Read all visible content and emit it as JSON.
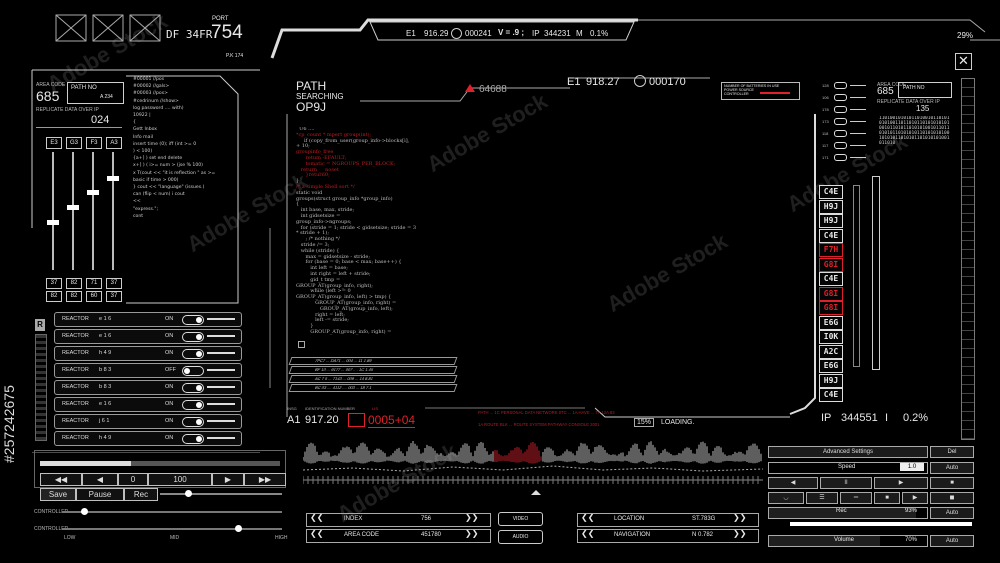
{
  "watermark": {
    "text": "Adobe Stock",
    "side_id": "#257242675"
  },
  "port": {
    "label": "PORT",
    "code": "DF 34FR",
    "value": "754",
    "sub": "P.K 174"
  },
  "top_bar": {
    "e1_label": "E1",
    "e1_value": "916.29",
    "counter": "000241",
    "v_label": "V = .9 ;",
    "ip_label": "IP",
    "ip_value": "344231",
    "m_label": "M",
    "m_value": "0.1%",
    "percent": "29%"
  },
  "area_code": {
    "label": "AREA CODE",
    "value": "685",
    "path_no_label": "PATH NO",
    "path_no_sub": "A 234",
    "replicate_label": "REPLICATE DATA OVER IP",
    "replicate_value": "024"
  },
  "notes_panel": {
    "lines": [
      "#00001 //pos",
      "#00002 //gals>",
      "#00003 //pos>",
      "#cedrinum //show>",
      "log password .... with)",
      "10922 |",
      "{ ",
      "Gett Inbox",
      "Info mail",
      "insert time (0); iff (int >= 0",
      ") < 100)",
      "{a+] ) set end delete",
      "x+] ) ( i>= num > (jse % 100)",
      "x T(cout << \"it is reflection \" as >= basic if time > 000)",
      "} cout << \"language\" (issues.)",
      "can (flip < num) i cout",
      "<<",
      "\"express.\";",
      "cont"
    ]
  },
  "sliders": {
    "labels": [
      "E3",
      "G3",
      "F3",
      "A3"
    ],
    "levels": [
      0.42,
      0.55,
      0.68,
      0.8
    ],
    "row1": [
      "37",
      "82",
      "71",
      "37"
    ],
    "row2": [
      "82",
      "82",
      "60",
      "37"
    ]
  },
  "r_badge": "R",
  "reactors": [
    {
      "name": "REACTOR",
      "id": "e 1 6",
      "state": "ON",
      "on": true
    },
    {
      "name": "REACTOR",
      "id": "e 1 6",
      "state": "ON",
      "on": true
    },
    {
      "name": "REACTOR",
      "id": "h 4 9",
      "state": "ON",
      "on": true
    },
    {
      "name": "REACTOR",
      "id": "b 8 3",
      "state": "OFF",
      "on": false
    },
    {
      "name": "REACTOR",
      "id": "b 8 3",
      "state": "ON",
      "on": true
    },
    {
      "name": "REACTOR",
      "id": "e 1 6",
      "state": "ON",
      "on": true
    },
    {
      "name": "REACTOR",
      "id": "j 6 1",
      "state": "ON",
      "on": true
    },
    {
      "name": "REACTOR",
      "id": "h 4 9",
      "state": "ON",
      "on": true
    }
  ],
  "transport": {
    "rewind": "◀◀",
    "back": "◀",
    "start": "0",
    "end": "100",
    "play": "▶",
    "ffwd": "▶▶",
    "save": "Save",
    "pause": "Pause",
    "rec": "Rec",
    "position": 0.38
  },
  "controllers": {
    "c1_label": "CONTROLLER",
    "c2_label": "CONTROLLER",
    "low": "LOW",
    "mid": "MID",
    "high": "HIGH",
    "c1_level": 0.1,
    "c2_level": 0.8
  },
  "path": {
    "title": "PATH",
    "status": "SEARCHING",
    "code": "OP9J",
    "alert_value": "64688",
    "e1_label": "E1",
    "e1_value": "918.27",
    "counter": "000170"
  },
  "code_lines": [
    {
      "t": "  U6 ....",
      "red": false
    },
    {
      "t": "*cp_count * mpert group(int);",
      "red": true
    },
    {
      "t": "     if (copy_from_user(group_info->blocks[i],",
      "red": false
    },
    {
      "t": "+ 10;",
      "red": false
    },
    {
      "t": "groupinfo_free",
      "red": true
    },
    {
      "t": "      retum -EFAULT;",
      "red": true
    },
    {
      "t": "      tomatic = NGROUPS_PER_BLOCK;",
      "red": true
    },
    {
      "t": "   return _ _noset",
      "red": true
    },
    {
      "t": "",
      "red": false
    },
    {
      "t": "      }return0;",
      "red": true
    },
    {
      "t": "}",
      "red": false
    },
    {
      "t": "/* a simple Shell sort */",
      "red": true
    },
    {
      "t": "static void",
      "red": false
    },
    {
      "t": "groups(struct group_info *group_info)",
      "red": false
    },
    {
      "t": "{",
      "red": false
    },
    {
      "t": "   int base, max, stride;",
      "red": false
    },
    {
      "t": "   int gidsetsize =",
      "red": false
    },
    {
      "t": "group_info->ngroups;",
      "red": false
    },
    {
      "t": "   for (stride = 1; stride < gidsetsize; stride = 3",
      "red": false
    },
    {
      "t": "* stride + 1);",
      "red": false
    },
    {
      "t": "      ; /* nothing */",
      "red": false
    },
    {
      "t": "   stride /= 3;",
      "red": false
    },
    {
      "t": "   while (stride) {",
      "red": false
    },
    {
      "t": "      max = gidsetsize - stride;",
      "red": false
    },
    {
      "t": "      for (base = 0; base < max; base++) {",
      "red": false
    },
    {
      "t": "         int left = base;",
      "red": false
    },
    {
      "t": "         int right = left + stride;",
      "red": false
    },
    {
      "t": "         gid_t tmp =",
      "red": false
    },
    {
      "t": "GROUP_AT(group_info, right);",
      "red": false
    },
    {
      "t": "         while (left >= 0",
      "red": false
    },
    {
      "t": "GROUP_AT(group_info, left) > tmp) {",
      "red": false
    },
    {
      "t": "            GROUP_AT(group_info, right) =",
      "red": false
    },
    {
      "t": "               GROUP_AT(group_info, left);",
      "red": false
    },
    {
      "t": "            right = left;",
      "red": false
    },
    {
      "t": "            left -= stride;",
      "red": false
    },
    {
      "t": "         }",
      "red": false
    },
    {
      "t": "         GROUP_AT(group_info, right) =",
      "red": false
    }
  ],
  "small_rows": [
    "7PC7 ... DA71 ... 004 ... 11 1.89",
    "BF 10 ... 9177 ... 007 .. . 1C 1.45",
    "AC 7 5 ... 7143 ... 009 ... 14 8.81",
    "BC 03 .... 4112 .... 003 ... 18 7.1"
  ],
  "readout": {
    "a1_label": "A1",
    "a1_value": "917.20",
    "red_value": "0005+04",
    "tiny_a": "INSG",
    "tiny_b": "IDENTIFICATION NUMBER",
    "tiny_c": "LIS"
  },
  "loading": {
    "red_line1": "PATH ... 1C PERSONAL DATA NETWORK 0TC ... 1A HAVE ... 7A 12A 83",
    "red_line2": "1A ROUTE BLK ... ROUTE SYSTEM PATHWAY CONSOLE 2001",
    "percent": "15%",
    "label": "LOADING."
  },
  "ip_readout": {
    "ip_label": "IP",
    "ip_value": "344551",
    "bar": "I",
    "pct": "0.2%"
  },
  "batteries": {
    "title": "NUMBER OF BATTERIES IN USE",
    "sub1": "POWER SOURCE",
    "sub2": "CONTROLLER"
  },
  "code_tags": [
    {
      "t": "C4E",
      "red": false
    },
    {
      "t": "H9J",
      "red": false
    },
    {
      "t": "H9J",
      "red": false
    },
    {
      "t": "C4E",
      "red": false
    },
    {
      "t": "F7H",
      "red": true
    },
    {
      "t": "G8I",
      "red": true
    },
    {
      "t": "C4E",
      "red": false
    },
    {
      "t": "G8I",
      "red": true
    },
    {
      "t": "G8I",
      "red": true
    },
    {
      "t": "E6G",
      "red": false
    },
    {
      "t": "I0K",
      "red": false
    },
    {
      "t": "A2C",
      "red": false
    },
    {
      "t": "E6G",
      "red": false
    },
    {
      "t": "H9J",
      "red": false
    },
    {
      "t": "C4E",
      "red": false
    }
  ],
  "right_area": {
    "label": "AREA CODE",
    "value": "685",
    "path_no": "PATH NO",
    "replicate": "REPLICATE DATA OVER IP",
    "replicate_value": "135"
  },
  "toggles_right": [
    "128",
    "106",
    "178",
    "173",
    "118",
    "117",
    "171"
  ],
  "binary": "1101001010101101001011010101010011011010110101010101001011010110101010010110110101011010101011010101010010101011010101101010101001011010",
  "bottom_nav": {
    "index_label": "INDEX",
    "index_value": "756",
    "area_label": "AREA CODE",
    "area_value": "451780",
    "video": "VIDEO",
    "audio": "AUDIO",
    "location_label": "LOCATION",
    "location_value": "ST.783G",
    "navigation_label": "NAVIGATION",
    "navigation_value": "N 0.782",
    "chev_left": "❮❮",
    "chev_right": "❯❯"
  },
  "advanced": {
    "title": "Advanced Settings",
    "del": "Del",
    "speed_label": "Speed",
    "speed_value": "1.0",
    "auto": "Auto",
    "rec_label": "Rec",
    "rec_pct": "93%",
    "rec_level": 0.93,
    "volume_label": "Volume",
    "volume_pct": "70%",
    "volume_level": 0.7,
    "row2_a": "◀",
    "row2_b": "II",
    "row2_c": "▶",
    "row3_a": "◡",
    "row3_d": "■",
    "row3_e": "▶",
    "row3_f": "◼"
  }
}
